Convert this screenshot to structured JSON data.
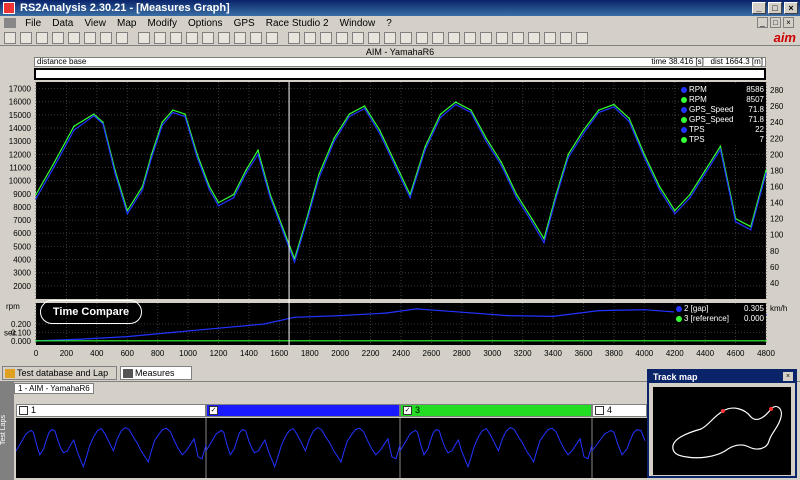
{
  "window": {
    "title": "RS2Analysis 2.30.21 - [Measures Graph]"
  },
  "menu": [
    "File",
    "Data",
    "View",
    "Map",
    "Modify",
    "Options",
    "GPS",
    "Race Studio 2",
    "Window",
    "?"
  ],
  "logo": "aim",
  "graph": {
    "header": "AIM - YamahaR6",
    "distance_base_label": "distance base",
    "time_readout": "time 38.416 [s]",
    "dist_readout": "dist 1664.3 [m]",
    "rpm_unit": "rpm",
    "speed_unit": "km/h",
    "sec_unit": "sec",
    "callout": "Time Compare"
  },
  "legend_top": [
    {
      "name": "RPM",
      "value": "8586",
      "color": "#2233ff"
    },
    {
      "name": "RPM",
      "value": "8507",
      "color": "#33ff33"
    },
    {
      "name": "GPS_Speed",
      "value": "71.8",
      "color": "#2233ff"
    },
    {
      "name": "GPS_Speed",
      "value": "71.8",
      "color": "#33ff33"
    },
    {
      "name": "TPS",
      "value": "22",
      "color": "#2233ff"
    },
    {
      "name": "TPS",
      "value": "7",
      "color": "#33ff33"
    }
  ],
  "legend_bottom": [
    {
      "name": "2 [gap]",
      "value": "0.305",
      "color": "#2233ff"
    },
    {
      "name": "3 [reference]",
      "value": "0.000",
      "color": "#33ff33"
    }
  ],
  "chart_data": {
    "type": "line",
    "x_ticks": [
      "0",
      "200",
      "400",
      "600",
      "800",
      "1000",
      "1200",
      "1400",
      "1600",
      "1800",
      "2000",
      "2200",
      "2400",
      "2600",
      "2800",
      "3000",
      "3200",
      "3400",
      "3600",
      "3800",
      "4000",
      "4200",
      "4400",
      "4600",
      "4800"
    ],
    "rpm_ticks": [
      "17000",
      "16000",
      "15000",
      "14000",
      "13000",
      "12000",
      "11000",
      "10000",
      "9000",
      "8000",
      "7000",
      "6000",
      "5000",
      "4000",
      "3000",
      "2000"
    ],
    "speed_ticks": [
      "280",
      "260",
      "240",
      "220",
      "200",
      "180",
      "160",
      "140",
      "120",
      "100",
      "80",
      "60",
      "40"
    ],
    "gap_ticks": [
      "0.200",
      "0.100",
      "0.000"
    ],
    "xlim": [
      0,
      4800
    ],
    "rpm_lim": [
      1000,
      17500
    ],
    "speed_lim": [
      20,
      290
    ],
    "gap_lim": [
      -0.05,
      0.45
    ],
    "cursor_x": 1664,
    "series": [
      {
        "name": "GPS_Speed",
        "color": "#33ff33",
        "x": [
          0,
          120,
          250,
          380,
          440,
          520,
          600,
          700,
          760,
          830,
          900,
          980,
          1060,
          1140,
          1200,
          1300,
          1380,
          1460,
          1540,
          1620,
          1700,
          1780,
          1860,
          1960,
          2060,
          2160,
          2260,
          2360,
          2460,
          2560,
          2660,
          2760,
          2860,
          2960,
          3060,
          3160,
          3260,
          3340,
          3420,
          3500,
          3600,
          3700,
          3800,
          3900,
          4000,
          4100,
          4200,
          4300,
          4400,
          4500,
          4600,
          4700,
          4800
        ],
        "values": [
          150,
          190,
          235,
          250,
          240,
          180,
          130,
          160,
          200,
          240,
          255,
          250,
          200,
          160,
          140,
          150,
          180,
          205,
          150,
          110,
          70,
          120,
          175,
          220,
          250,
          260,
          230,
          190,
          150,
          210,
          250,
          265,
          255,
          220,
          190,
          150,
          120,
          95,
          150,
          200,
          230,
          255,
          262,
          245,
          200,
          160,
          130,
          150,
          180,
          210,
          120,
          110,
          180
        ]
      },
      {
        "name": "GPS_Speed",
        "color": "#2233ff",
        "x": [
          0,
          120,
          250,
          380,
          440,
          520,
          600,
          700,
          760,
          830,
          900,
          980,
          1060,
          1140,
          1200,
          1300,
          1380,
          1460,
          1540,
          1620,
          1700,
          1780,
          1860,
          1960,
          2060,
          2160,
          2260,
          2360,
          2460,
          2560,
          2660,
          2760,
          2860,
          2960,
          3060,
          3160,
          3260,
          3340,
          3420,
          3500,
          3600,
          3700,
          3800,
          3900,
          4000,
          4100,
          4200,
          4300,
          4400,
          4500,
          4600,
          4700,
          4800
        ],
        "values": [
          145,
          185,
          230,
          248,
          238,
          176,
          126,
          156,
          196,
          236,
          252,
          247,
          196,
          156,
          136,
          146,
          176,
          200,
          146,
          106,
          66,
          116,
          170,
          216,
          247,
          257,
          226,
          186,
          146,
          206,
          246,
          262,
          252,
          216,
          186,
          146,
          116,
          90,
          146,
          196,
          226,
          252,
          259,
          241,
          196,
          156,
          126,
          146,
          176,
          206,
          116,
          106,
          176
        ]
      }
    ],
    "gap_series": [
      {
        "name": "2 [gap]",
        "color": "#2233ff",
        "x": [
          0,
          300,
          600,
          900,
          1200,
          1500,
          1700,
          2000,
          2300,
          2500,
          2800,
          3100,
          3400,
          3700,
          4000,
          4300,
          4600,
          4800
        ],
        "values": [
          0.0,
          0.02,
          0.05,
          0.1,
          0.15,
          0.2,
          0.28,
          0.3,
          0.33,
          0.38,
          0.34,
          0.3,
          0.29,
          0.36,
          0.37,
          0.33,
          0.3,
          0.31
        ]
      },
      {
        "name": "3 [reference]",
        "color": "#33ff33",
        "x": [
          0,
          4800
        ],
        "values": [
          0.0,
          0.0
        ]
      }
    ]
  },
  "tabs": [
    {
      "label": "Test database and Lap manager"
    },
    {
      "label": "Measures Graph"
    }
  ],
  "lower": {
    "subtab": "1 - AIM - YamahaR6",
    "sidelabel": "Test Laps",
    "laps": [
      {
        "label": "1",
        "color": "#ffffff",
        "checked": false
      },
      {
        "label": "",
        "color": "#1a1aff",
        "checked": true
      },
      {
        "label": "3",
        "color": "#22dd22",
        "checked": true
      },
      {
        "label": "4",
        "color": "#ffffff",
        "checked": false
      }
    ]
  },
  "trackmap": {
    "title": "Track map"
  }
}
